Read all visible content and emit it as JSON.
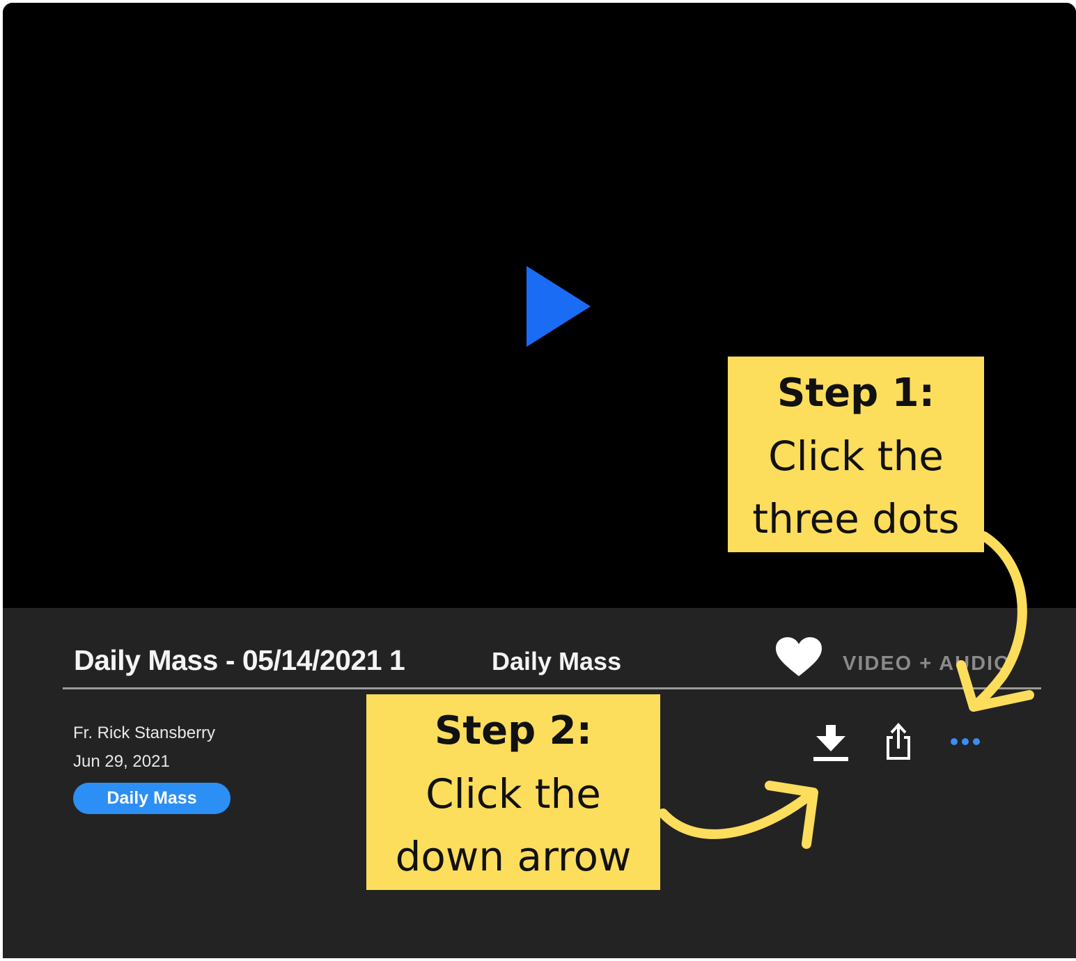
{
  "media": {
    "title": "Daily Mass - 05/14/2021 1",
    "series_link": "Daily Mass",
    "media_type_label": "VIDEO + AUDIO",
    "speaker": "Fr. Rick Stansberry",
    "date": "Jun 29, 2021",
    "tag": "Daily Mass"
  },
  "icons": {
    "play": "play-icon",
    "favorite": "heart-icon",
    "download": "download-icon",
    "share": "share-icon",
    "more": "more-dots-icon"
  },
  "callouts": {
    "step1": {
      "heading": "Step 1:",
      "line1": "Click the",
      "line2": "three dots"
    },
    "step2": {
      "heading": "Step 2:",
      "line1": "Click the",
      "line2": "down arrow"
    }
  },
  "colors": {
    "accent_blue": "#1a6cf5",
    "tag_blue": "#2b8ff5",
    "more_dots_blue": "#3a8ef5",
    "callout_yellow": "#fddd5c",
    "panel_bg": "#232323"
  }
}
